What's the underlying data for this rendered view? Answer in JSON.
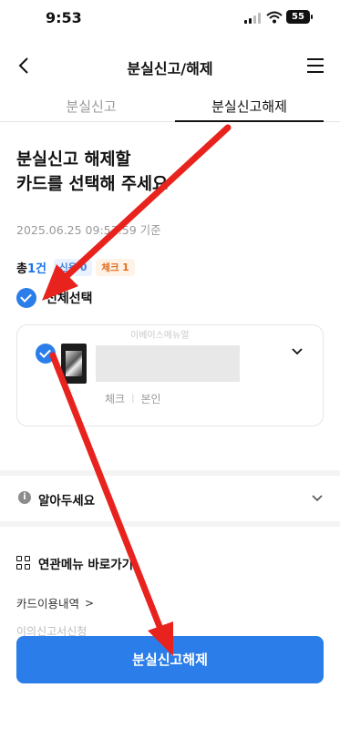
{
  "status_bar": {
    "time": "9:53",
    "battery": "55"
  },
  "header": {
    "title": "분실신고/해제",
    "back_icon": "chevron-left-icon",
    "menu_icon": "hamburger-menu-icon"
  },
  "tabs": [
    {
      "label": "분실신고",
      "active": false
    },
    {
      "label": "분실신고해제",
      "active": true
    }
  ],
  "main": {
    "heading_line1": "분실신고 해제할",
    "heading_line2": "카드를 선택해 주세요",
    "timestamp": "2025.06.25 09:53:59 기준"
  },
  "summary": {
    "total_prefix": "총 ",
    "total_count": "1건",
    "credit_chip": "신용 0",
    "check_chip": "체크 1"
  },
  "select_all": {
    "label": "전체선택",
    "checked": true
  },
  "card": {
    "checked": true,
    "watermark": "이베이스메뉴얼",
    "type": "체크",
    "owner": "본인"
  },
  "notice": {
    "label": "알아두세요"
  },
  "related": {
    "label": "연관메뉴 바로가기",
    "links": [
      "카드이용내역",
      "이의신고서신청"
    ]
  },
  "action": {
    "button_label": "분실신고해제"
  },
  "colors": {
    "primary": "#2b7de9",
    "arrow": "#e8231e"
  }
}
